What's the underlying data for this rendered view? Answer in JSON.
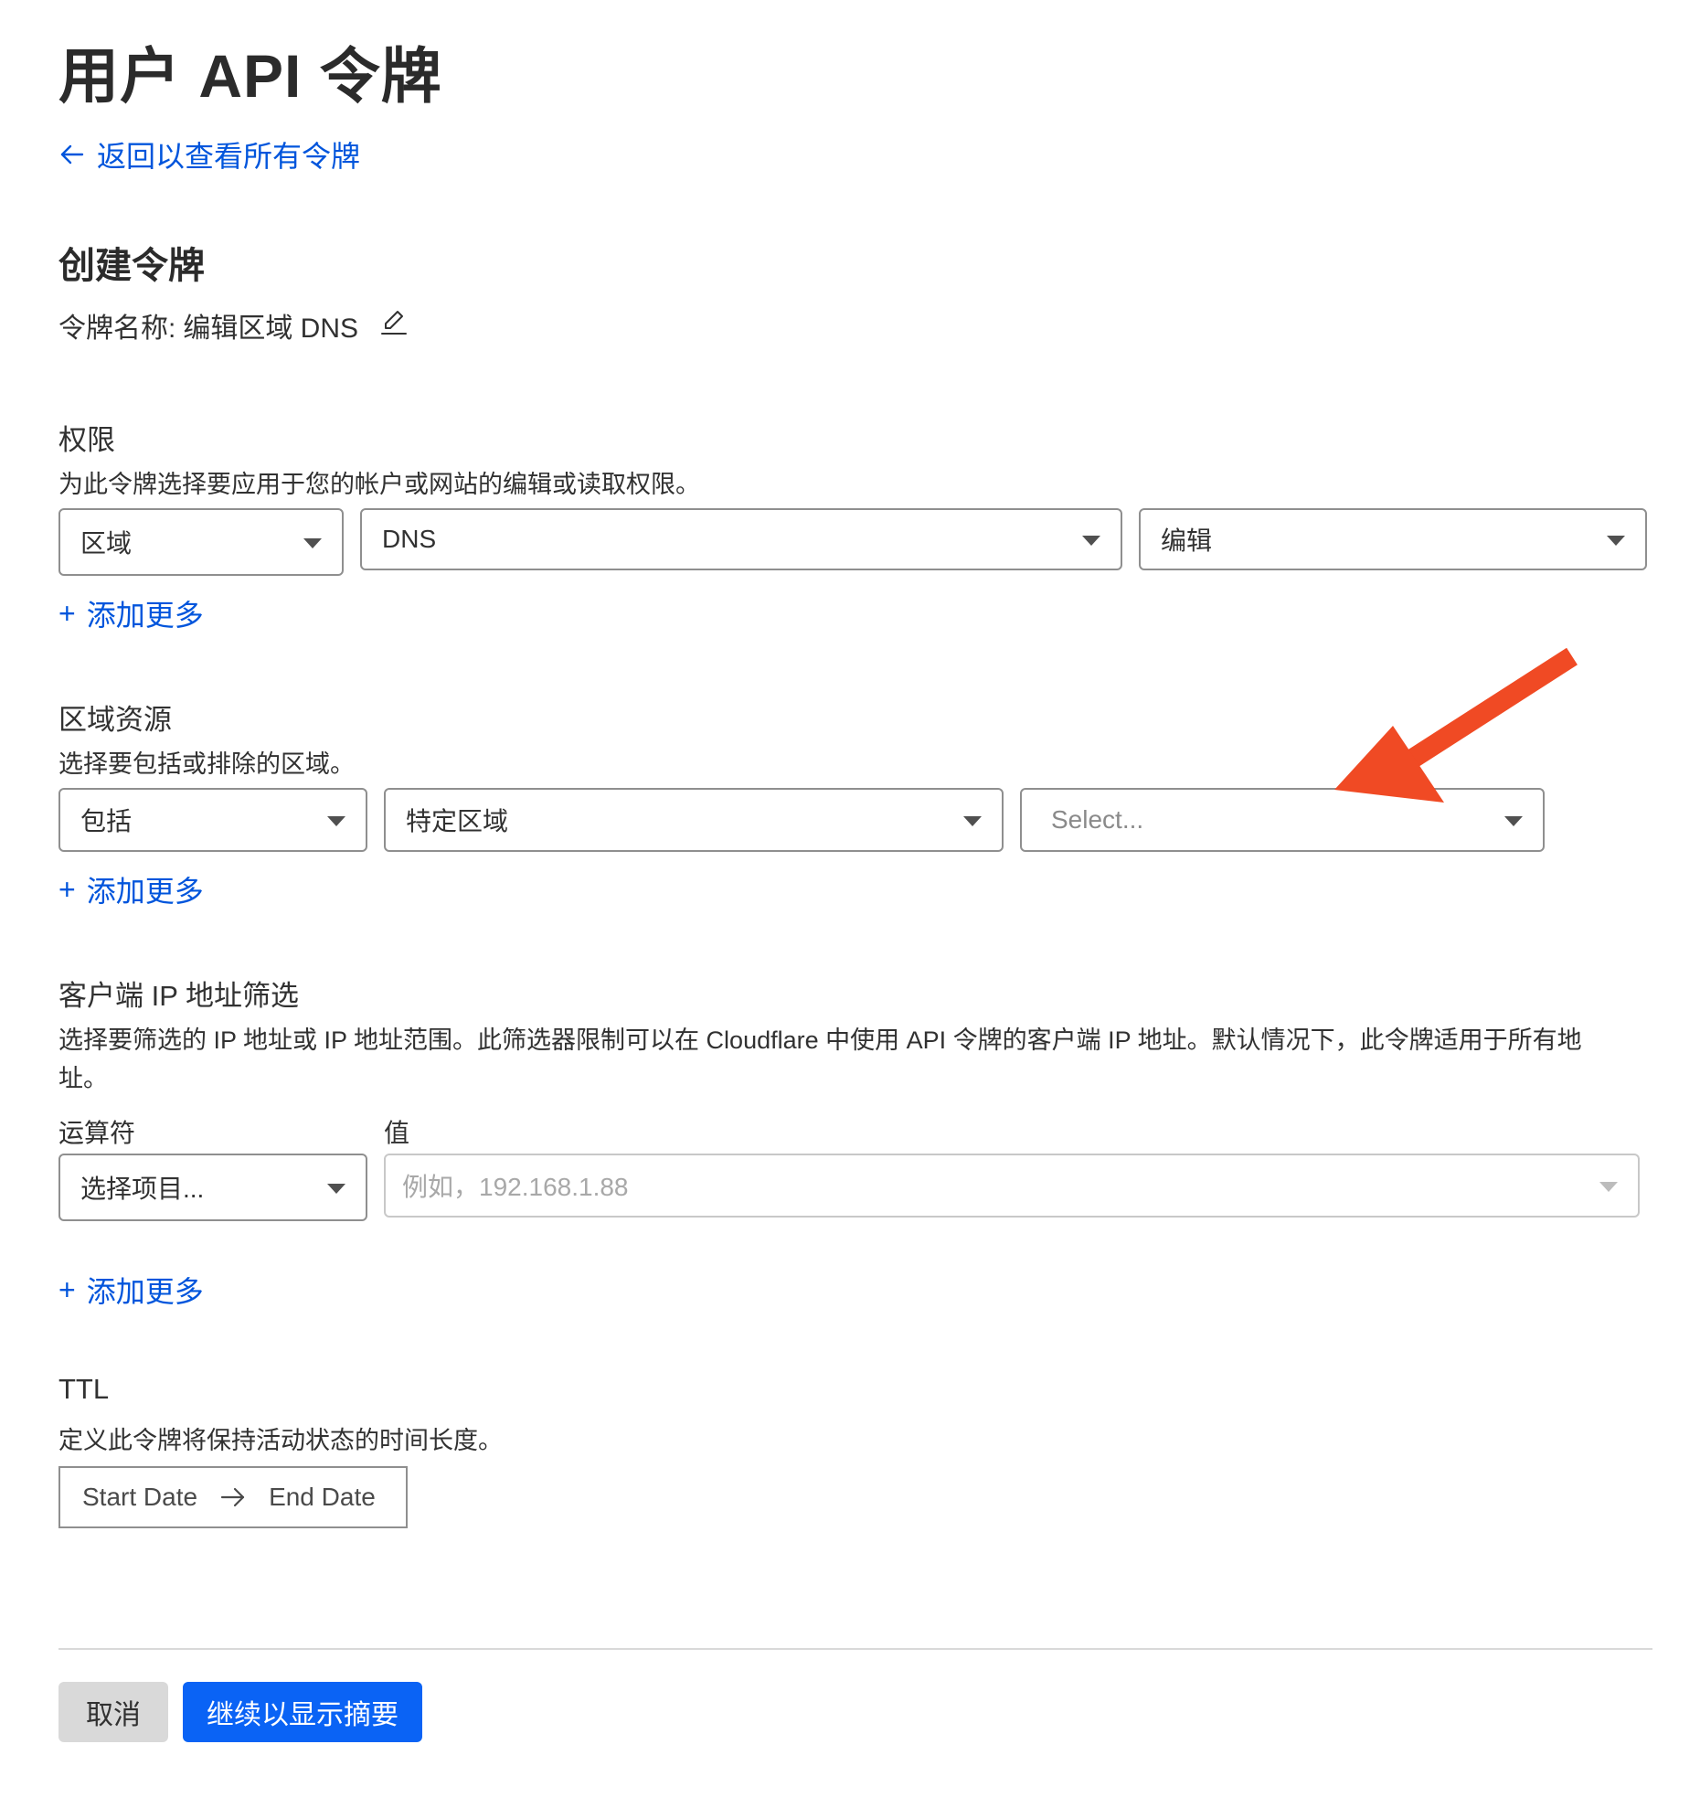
{
  "page_title": "用户 API 令牌",
  "back_link": "返回以查看所有令牌",
  "section_title": "创建令牌",
  "token_name": {
    "label": "令牌名称:",
    "value": "编辑区域 DNS"
  },
  "permissions": {
    "title": "权限",
    "description": "为此令牌选择要应用于您的帐户或网站的编辑或读取权限。",
    "selects": [
      "区域",
      "DNS",
      "编辑"
    ],
    "add_more": "添加更多"
  },
  "zone_resources": {
    "title": "区域资源",
    "description": "选择要包括或排除的区域。",
    "selects": [
      "包括",
      "特定区域"
    ],
    "zone_select_placeholder": "Select...",
    "add_more": "添加更多"
  },
  "client_ip_filter": {
    "title": "客户端 IP 地址筛选",
    "description_line1": "选择要筛选的 IP 地址或 IP 地址范围。此筛选器限制可以在 Cloudflare 中使用 API 令牌的客户端 IP 地址。默认情况下，此令牌适用于所有地",
    "description_line2": "址。",
    "operator_label": "运算符",
    "value_label": "值",
    "operator_placeholder": "选择项目...",
    "value_placeholder": "例如，192.168.1.88",
    "add_more": "添加更多"
  },
  "ttl": {
    "title": "TTL",
    "description": "定义此令牌将保持活动状态的时间长度。",
    "start_date": "Start Date",
    "end_date": "End Date"
  },
  "buttons": {
    "cancel": "取消",
    "continue": "继续以显示摘要"
  },
  "colors": {
    "link": "#0055dc",
    "primary_button": "#0a63f5",
    "cancel_button": "#d9d9d9",
    "annotation_arrow": "#f04a24"
  },
  "icons": {
    "back": "arrow-left-icon",
    "edit": "pencil-icon",
    "add": "plus-icon",
    "dropdown": "caret-down-icon",
    "date_range": "arrow-right-icon"
  }
}
